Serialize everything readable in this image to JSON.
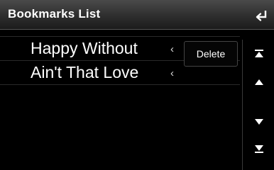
{
  "header": {
    "title": "Bookmarks List",
    "back_icon": "back-arrow-icon"
  },
  "bookmarks": [
    {
      "title": "Happy Without"
    },
    {
      "title": "Ain't That Love"
    }
  ],
  "actions": {
    "delete_label": "Delete"
  },
  "scroll": {
    "icons": [
      "jump-to-top-icon",
      "scroll-up-icon",
      "scroll-down-icon",
      "jump-to-bottom-icon"
    ]
  }
}
